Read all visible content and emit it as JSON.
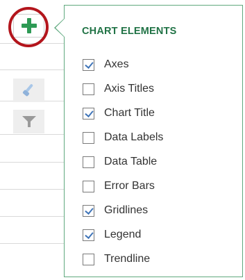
{
  "side_buttons": {
    "add": {
      "icon": "plus-icon",
      "color": "#2e9a55"
    },
    "styles": {
      "icon": "brush-icon"
    },
    "filters": {
      "icon": "filter-icon"
    },
    "highlight_color": "#b3151c"
  },
  "flyout": {
    "title": "CHART ELEMENTS",
    "title_color": "#217346",
    "options": [
      {
        "label": "Axes",
        "checked": true
      },
      {
        "label": "Axis Titles",
        "checked": false
      },
      {
        "label": "Chart Title",
        "checked": true
      },
      {
        "label": "Data Labels",
        "checked": false
      },
      {
        "label": "Data Table",
        "checked": false
      },
      {
        "label": "Error Bars",
        "checked": false
      },
      {
        "label": "Gridlines",
        "checked": true
      },
      {
        "label": "Legend",
        "checked": true
      },
      {
        "label": "Trendline",
        "checked": false
      }
    ]
  }
}
